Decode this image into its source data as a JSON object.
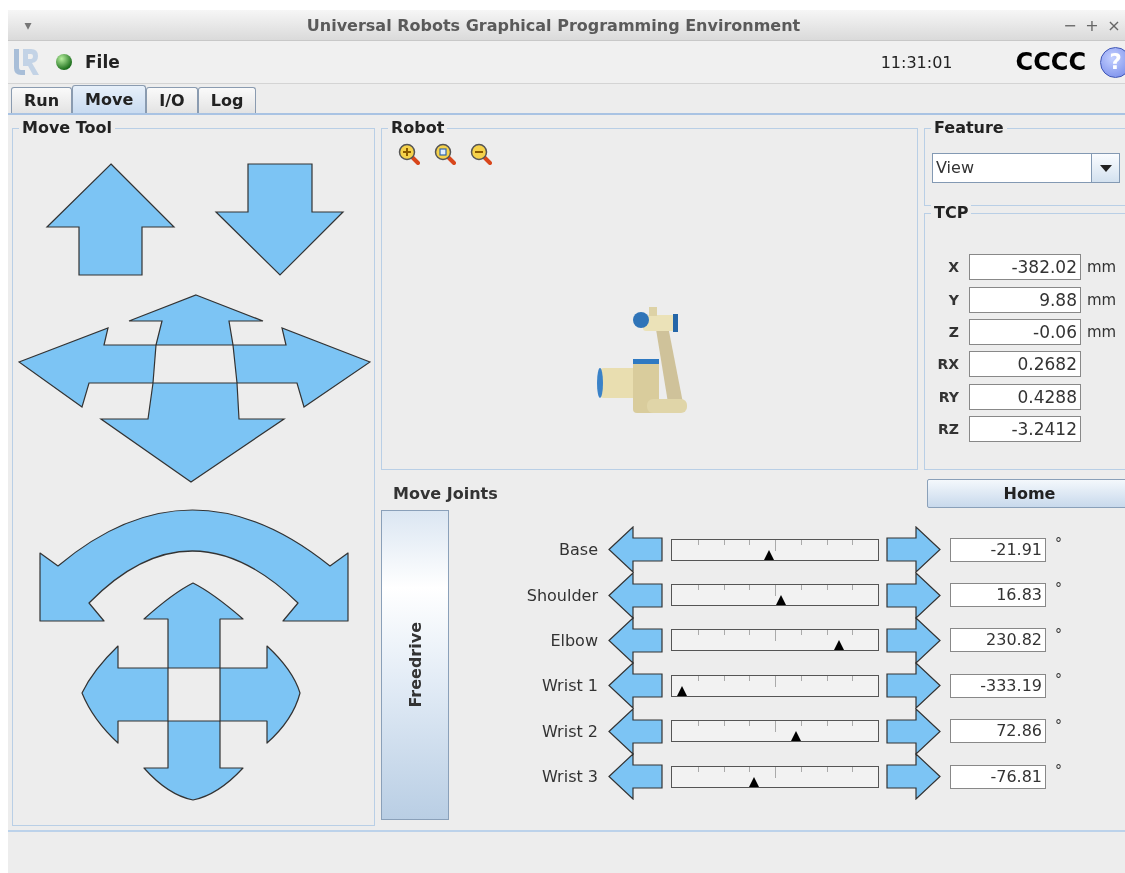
{
  "window": {
    "title": "Universal Robots Graphical Programming Environment",
    "menu_caret": "▾",
    "controls": [
      "−",
      "+",
      "×"
    ]
  },
  "toolbar": {
    "menu": "File",
    "clock": "11:31:01",
    "robot_name": "CCCC",
    "help": "?"
  },
  "tabs": [
    {
      "label": "Run",
      "selected": false
    },
    {
      "label": "Move",
      "selected": true
    },
    {
      "label": "I/O",
      "selected": false
    },
    {
      "label": "Log",
      "selected": false
    }
  ],
  "move_tool": {
    "title": "Move Tool"
  },
  "robot": {
    "title": "Robot"
  },
  "feature": {
    "title": "Feature",
    "value": "View"
  },
  "tcp": {
    "title": "TCP",
    "fields": [
      {
        "label": "X",
        "value": "-382.02",
        "unit": "mm"
      },
      {
        "label": "Y",
        "value": "9.88",
        "unit": "mm"
      },
      {
        "label": "Z",
        "value": "-0.06",
        "unit": "mm"
      },
      {
        "label": "RX",
        "value": "0.2682"
      },
      {
        "label": "RY",
        "value": "0.4288"
      },
      {
        "label": "RZ",
        "value": "-3.2412"
      }
    ]
  },
  "move_joints": {
    "title": "Move Joints",
    "home": "Home",
    "freedrive": "Freedrive",
    "joints": [
      {
        "name": "Base",
        "level": 0.47,
        "value": "-21.91",
        "unit": "°"
      },
      {
        "name": "Shoulder",
        "level": 0.53,
        "value": "16.83",
        "unit": "°"
      },
      {
        "name": "Elbow",
        "level": 0.81,
        "value": "230.82",
        "unit": "°"
      },
      {
        "name": "Wrist 1",
        "level": 0.05,
        "value": "-333.19",
        "unit": "°"
      },
      {
        "name": "Wrist 2",
        "level": 0.6,
        "value": "72.86",
        "unit": "°"
      },
      {
        "name": "Wrist 3",
        "level": 0.4,
        "value": "-76.81",
        "unit": "°"
      }
    ]
  }
}
